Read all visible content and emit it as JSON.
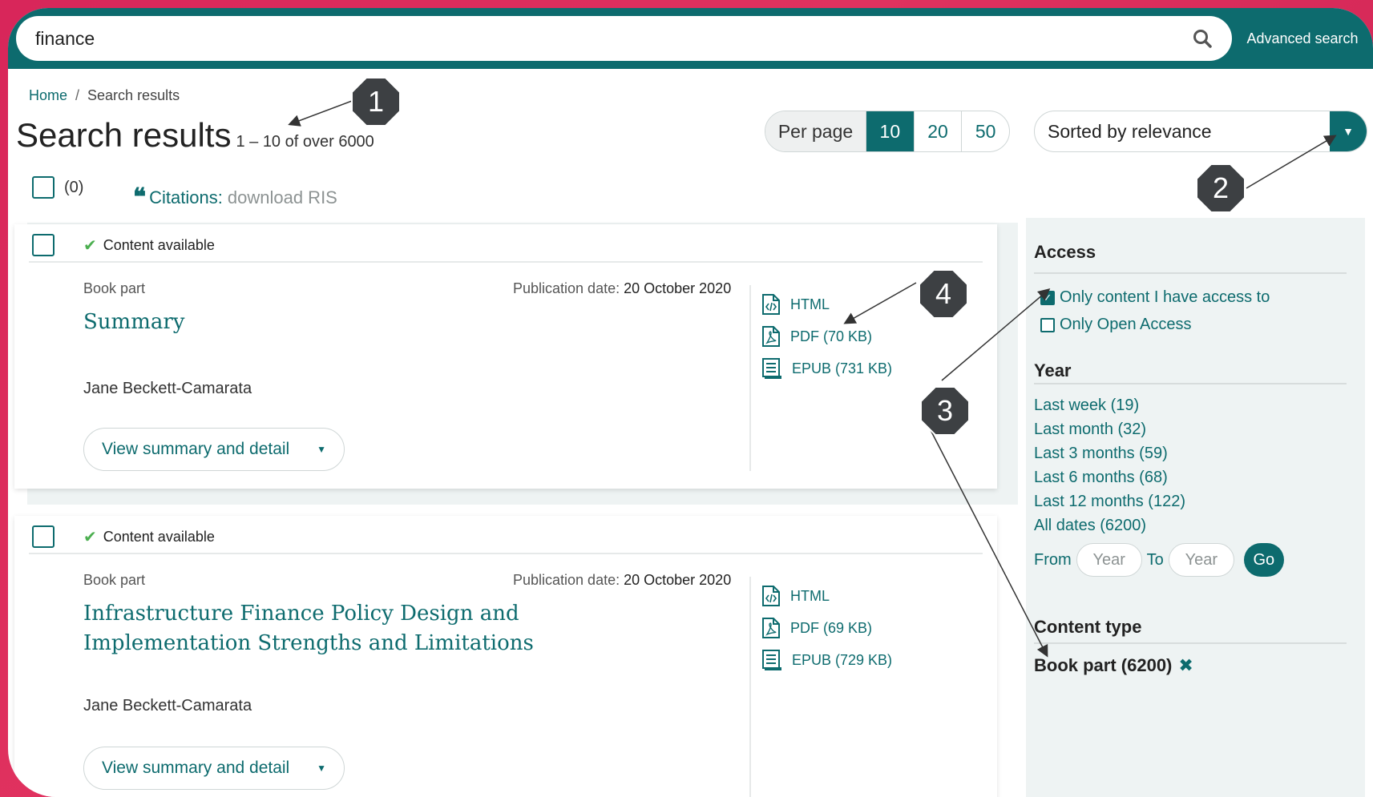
{
  "search": {
    "value": "finance",
    "advanced_label": "Advanced search"
  },
  "breadcrumb": {
    "home": "Home",
    "sep": "/",
    "current": "Search results"
  },
  "header": {
    "title": "Search results",
    "count": "1 – 10 of over 6000"
  },
  "perpage": {
    "label": "Per page",
    "options": [
      "10",
      "20",
      "50"
    ],
    "selected": "10"
  },
  "sort": {
    "value": "Sorted by relevance"
  },
  "selection": {
    "count": "(0)"
  },
  "citations": {
    "label": "Citations:",
    "action": "download RIS"
  },
  "results": [
    {
      "availability": "Content available",
      "type": "Book part",
      "pub_label": "Publication date:",
      "pub_date": "20 October 2020",
      "title": "Summary",
      "author": "Jane Beckett-Camarata",
      "view_label": "View summary and detail",
      "formats": [
        "HTML",
        "PDF (70 KB)",
        "EPUB (731 KB)"
      ]
    },
    {
      "availability": "Content available",
      "type": "Book part",
      "pub_label": "Publication date:",
      "pub_date": "20 October 2020",
      "title": "Infrastructure Finance Policy Design and Implementation Strengths and Limitations",
      "author": "Jane Beckett-Camarata",
      "view_label": "View summary and detail",
      "formats": [
        "HTML",
        "PDF (69 KB)",
        "EPUB (729 KB)"
      ]
    }
  ],
  "sidebar": {
    "access_heading": "Access",
    "access_options": [
      {
        "label": "Only content I have access to",
        "checked": true
      },
      {
        "label": "Only Open Access",
        "checked": false
      }
    ],
    "year_heading": "Year",
    "year_links": [
      "Last week (19)",
      "Last month (32)",
      "Last 3 months (59)",
      "Last 6 months (68)",
      "Last 12 months (122)",
      "All dates (6200)"
    ],
    "from_label": "From",
    "to_label": "To",
    "year_placeholder": "Year",
    "go_label": "Go",
    "content_type_heading": "Content type",
    "content_type_value": "Book part (6200)"
  },
  "markers": [
    "1",
    "2",
    "3",
    "4"
  ],
  "colors": {
    "accent": "#0d6b6e",
    "frame": "#d8265a",
    "marker": "#3d4043"
  }
}
